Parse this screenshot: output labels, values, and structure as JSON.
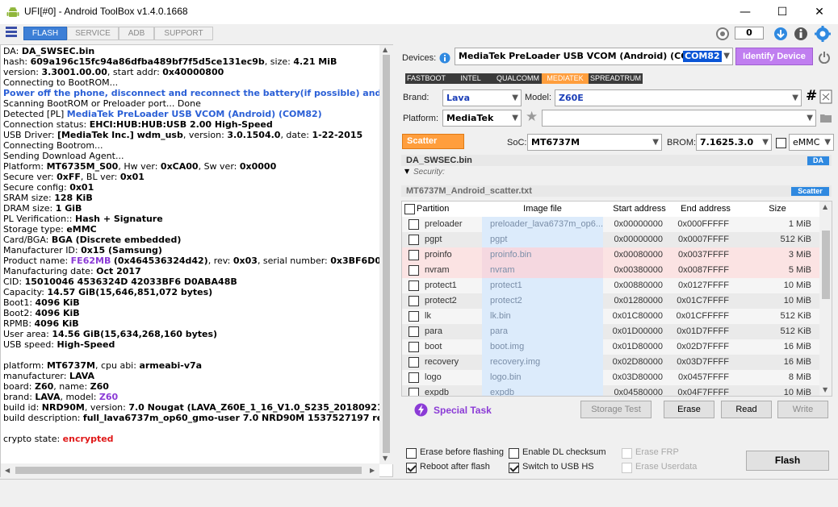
{
  "window": {
    "title": "UFI[#0] - Android ToolBox v1.4.0.1668",
    "minimize": "—",
    "maximize": "☐",
    "close": "✕"
  },
  "tabs": [
    "FLASH",
    "SERVICE",
    "ADB",
    "SUPPORT"
  ],
  "counter": "0",
  "log": [
    [
      [
        "DA: "
      ],
      [
        "DA_SWSEC.bin",
        "b"
      ]
    ],
    [
      [
        " hash: "
      ],
      [
        "609a196c15fc94a86dfba489bf7f5d5ce131ec9b",
        "b"
      ],
      [
        ", size: "
      ],
      [
        "4.21 MiB",
        "b"
      ]
    ],
    [
      [
        " version: "
      ],
      [
        "3.3001.00.00",
        "b"
      ],
      [
        ", start addr: "
      ],
      [
        "0x40000800",
        "b"
      ]
    ],
    [
      [
        "Connecting to BootROM..."
      ]
    ],
    [
      [
        " Power off the phone, disconnect and reconnect the battery(if possible) and connect",
        "blue"
      ]
    ],
    [
      [
        " Scanning BootROM or Preloader port... Done"
      ]
    ],
    [
      [
        " Detected [PL] "
      ],
      [
        "MediaTek PreLoader USB VCOM (Android) (COM82)",
        "blue"
      ]
    ],
    [
      [
        " Connection status: "
      ],
      [
        "EHCI:HUB:HUB:USB 2.00 High-Speed",
        "b"
      ]
    ],
    [
      [
        " USB Driver: "
      ],
      [
        "[MediaTek Inc.] wdm_usb",
        "b"
      ],
      [
        ", version: "
      ],
      [
        "3.0.1504.0",
        "b"
      ],
      [
        ", date: "
      ],
      [
        "1-22-2015",
        "b"
      ]
    ],
    [
      [
        "Connecting Bootrom..."
      ]
    ],
    [
      [
        "Sending Download Agent..."
      ]
    ],
    [
      [
        "Platform: "
      ],
      [
        "MT6735M_S00",
        "b"
      ],
      [
        ", Hw ver: "
      ],
      [
        "0xCA00",
        "b"
      ],
      [
        ", Sw ver: "
      ],
      [
        "0x0000",
        "b"
      ]
    ],
    [
      [
        " Secure ver: "
      ],
      [
        "0xFF",
        "b"
      ],
      [
        ", BL ver: "
      ],
      [
        "0x01",
        "b"
      ]
    ],
    [
      [
        " Secure config: "
      ],
      [
        "0x01",
        "b"
      ]
    ],
    [
      [
        " SRAM size: "
      ],
      [
        "128 KiB",
        "b"
      ]
    ],
    [
      [
        "DRAM size: "
      ],
      [
        "1 GiB",
        "b"
      ]
    ],
    [
      [
        "PL Verification:: "
      ],
      [
        "Hash + Signature",
        "b"
      ]
    ],
    [
      [
        "Storage type: "
      ],
      [
        "eMMC",
        "b"
      ]
    ],
    [
      [
        "Card/BGA: "
      ],
      [
        "BGA (Discrete embedded)",
        "b"
      ]
    ],
    [
      [
        "Manufacturer ID: "
      ],
      [
        "0x15 (Samsung)",
        "b"
      ]
    ],
    [
      [
        "Product name: "
      ],
      [
        "FE62MB",
        "purple"
      ],
      [
        " "
      ],
      [
        "(0x464536324d42)",
        "b"
      ],
      [
        ", rev: "
      ],
      [
        "0x03",
        "b"
      ],
      [
        ", serial number: "
      ],
      [
        "0x3BF6D0AB",
        "b"
      ]
    ],
    [
      [
        "Manufacturing date: "
      ],
      [
        "Oct 2017",
        "b"
      ]
    ],
    [
      [
        "CID: "
      ],
      [
        "15010046 4536324D 42033BF6 D0ABA48B",
        "b"
      ]
    ],
    [
      [
        "Capacity: "
      ],
      [
        "14.57 GiB(15,646,851,072 bytes)",
        "b"
      ]
    ],
    [
      [
        " Boot1: "
      ],
      [
        "4096 KiB",
        "b"
      ]
    ],
    [
      [
        " Boot2: "
      ],
      [
        "4096 KiB",
        "b"
      ]
    ],
    [
      [
        " RPMB: "
      ],
      [
        "4096 KiB",
        "b"
      ]
    ],
    [
      [
        " User area: "
      ],
      [
        "14.56 GiB(15,634,268,160 bytes)",
        "b"
      ]
    ],
    [
      [
        "USB speed: "
      ],
      [
        "High-Speed",
        "b"
      ]
    ],
    [
      [
        ""
      ]
    ],
    [
      [
        "platform: "
      ],
      [
        "MT6737M",
        "b"
      ],
      [
        ", cpu abi: "
      ],
      [
        "armeabi-v7a",
        "b"
      ]
    ],
    [
      [
        "manufacturer: "
      ],
      [
        "LAVA",
        "b"
      ]
    ],
    [
      [
        "board: "
      ],
      [
        "Z60",
        "b"
      ],
      [
        ", name: "
      ],
      [
        "Z60",
        "b"
      ]
    ],
    [
      [
        "brand: "
      ],
      [
        "LAVA",
        "b"
      ],
      [
        ", model: "
      ],
      [
        "Z60",
        "purple"
      ]
    ],
    [
      [
        "build id: "
      ],
      [
        "NRD90M",
        "b"
      ],
      [
        ", version: "
      ],
      [
        "7.0 Nougat (LAVA_Z60E_1_16_V1.0_S235_20180921_ENG_",
        "b"
      ]
    ],
    [
      [
        "build description: "
      ],
      [
        "full_lava6737m_op60_gmo-user 7.0  NRD90M 1537527197 release-",
        "b"
      ]
    ],
    [
      [
        ""
      ]
    ],
    [
      [
        "crypto state: "
      ],
      [
        "encrypted",
        "red"
      ]
    ]
  ],
  "devices": {
    "label": "Devices:",
    "value": "MediaTek PreLoader USB VCOM (Android) (COM82)",
    "selected": "COM82",
    "identify": "Identify Device"
  },
  "vendor_tabs": [
    "FASTBOOT",
    "INTEL",
    "QUALCOMM",
    "MEDIATEK",
    "SPREADTRUM"
  ],
  "brand": {
    "label": "Brand:",
    "value": "Lava"
  },
  "model": {
    "label": "Model:",
    "value": "Z60E"
  },
  "platform": {
    "label": "Platform:",
    "value": "MediaTek"
  },
  "scatter_btn": "Scatter",
  "soc": {
    "label": "SoC:",
    "value": "MT6737M"
  },
  "brom": {
    "label": "BROM:",
    "value": "7.1625.3.0"
  },
  "storage": "eMMC",
  "da": {
    "file": "DA_SWSEC.bin",
    "badge": "DA",
    "security": "Security:"
  },
  "scatter": {
    "file": "MT6737M_Android_scatter.txt",
    "badge": "Scatter"
  },
  "grid": {
    "headers": [
      "Partition",
      "Image file",
      "Start address",
      "End address",
      "Size"
    ],
    "rows": [
      {
        "p": "preloader",
        "f": "preloader_lava6737m_op6...",
        "s": "0x00000000",
        "e": "0x000FFFFF",
        "z": "1 MiB",
        "t": "n"
      },
      {
        "p": "pgpt",
        "f": "pgpt",
        "s": "0x00000000",
        "e": "0x0007FFFF",
        "z": "512 KiB",
        "t": "n"
      },
      {
        "p": "proinfo",
        "f": "proinfo.bin",
        "s": "0x00080000",
        "e": "0x0037FFFF",
        "z": "3 MiB",
        "t": "p"
      },
      {
        "p": "nvram",
        "f": "nvram",
        "s": "0x00380000",
        "e": "0x0087FFFF",
        "z": "5 MiB",
        "t": "p"
      },
      {
        "p": "protect1",
        "f": "protect1",
        "s": "0x00880000",
        "e": "0x0127FFFF",
        "z": "10 MiB",
        "t": "n"
      },
      {
        "p": "protect2",
        "f": "protect2",
        "s": "0x01280000",
        "e": "0x01C7FFFF",
        "z": "10 MiB",
        "t": "n"
      },
      {
        "p": "lk",
        "f": "lk.bin",
        "s": "0x01C80000",
        "e": "0x01CFFFFF",
        "z": "512 KiB",
        "t": "n"
      },
      {
        "p": "para",
        "f": "para",
        "s": "0x01D00000",
        "e": "0x01D7FFFF",
        "z": "512 KiB",
        "t": "n"
      },
      {
        "p": "boot",
        "f": "boot.img",
        "s": "0x01D80000",
        "e": "0x02D7FFFF",
        "z": "16 MiB",
        "t": "n"
      },
      {
        "p": "recovery",
        "f": "recovery.img",
        "s": "0x02D80000",
        "e": "0x03D7FFFF",
        "z": "16 MiB",
        "t": "n"
      },
      {
        "p": "logo",
        "f": "logo.bin",
        "s": "0x03D80000",
        "e": "0x0457FFFF",
        "z": "8 MiB",
        "t": "n"
      },
      {
        "p": "expdb",
        "f": "expdb",
        "s": "0x04580000",
        "e": "0x04F7FFFF",
        "z": "10 MiB",
        "t": "n"
      }
    ]
  },
  "special_task": "Special Task",
  "actions": [
    "Storage Test",
    "Erase",
    "Read",
    "Write"
  ],
  "options": [
    {
      "label": "Erase before flashing",
      "on": false,
      "dis": false
    },
    {
      "label": "Enable DL checksum",
      "on": false,
      "dis": false
    },
    {
      "label": "Erase FRP",
      "on": false,
      "dis": true
    },
    {
      "label": "Reboot after flash",
      "on": true,
      "dis": false
    },
    {
      "label": "Switch to USB HS",
      "on": true,
      "dis": false
    },
    {
      "label": "Erase Userdata",
      "on": false,
      "dis": true
    }
  ],
  "flash_btn": "Flash"
}
